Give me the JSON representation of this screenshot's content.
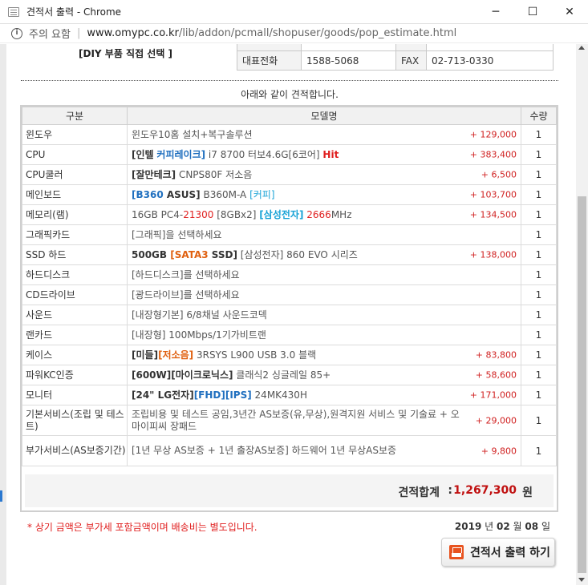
{
  "window": {
    "title": "견적서 출력 - Chrome",
    "minimize": "─",
    "maximize": "☐",
    "close": "✕"
  },
  "address": {
    "warning": "주의 요함",
    "host": "www.omypc.co.kr",
    "path": "/lib/addon/pcmall/shopuser/goods/pop_estimate.html"
  },
  "header": {
    "top_fragment": "",
    "diy_label": "[DIY 부품 직접 선택 ]",
    "info": {
      "top_left": "",
      "top_mid": "",
      "top_right_label": "",
      "top_right": "",
      "phone_label": "대표전화",
      "phone": "1588-5068",
      "fax_label": "FAX",
      "fax": "02-713-0330"
    }
  },
  "subtitle": "아래와 같이 견적합니다.",
  "table": {
    "col_category": "구분",
    "col_model": "모델명",
    "col_qty": "수량",
    "rows": [
      {
        "category": "윈도우",
        "model": "윈도우10홈 설치+복구솔루션",
        "price": "+ 129,000",
        "qty": "1"
      },
      {
        "category": "CPU",
        "price": "+ 383,400",
        "qty": "1"
      },
      {
        "category": "CPU쿨러",
        "price": "+ 6,500",
        "qty": "1"
      },
      {
        "category": "메인보드",
        "price": "+ 103,700",
        "qty": "1"
      },
      {
        "category": "메모리(램)",
        "price": "+ 134,500",
        "qty": "1"
      },
      {
        "category": "그래픽카드",
        "model": "[그래픽]을 선택하세요",
        "price": "",
        "qty": "1"
      },
      {
        "category": "SSD 하드",
        "price": "+ 138,000",
        "qty": "1"
      },
      {
        "category": "하드디스크",
        "model": "[하드디스크]를 선택하세요",
        "price": "",
        "qty": "1"
      },
      {
        "category": "CD드라이브",
        "model": "[광드라이브]를 선택하세요",
        "price": "",
        "qty": "1"
      },
      {
        "category": "사운드",
        "model": "[내장형기본] 6/8채널 사운드코덱",
        "price": "",
        "qty": "1"
      },
      {
        "category": "랜카드",
        "model": "[내장형] 100Mbps/1기가비트랜",
        "price": "",
        "qty": "1"
      },
      {
        "category": "케이스",
        "price": "+ 83,800",
        "qty": "1"
      },
      {
        "category": "파워KC인증",
        "price": "+ 58,600",
        "qty": "1"
      },
      {
        "category": "모니터",
        "price": "+ 171,000",
        "qty": "1"
      },
      {
        "category": "기본서비스(조립 및 테스트)",
        "model": "조립비용 및 테스트 공임,3년간 AS보증(유,무상),원격지원 서비스 및 기술료 + 오마이피씨 장패드",
        "price": "+ 29,000",
        "qty": "1"
      },
      {
        "category": "부가서비스(AS보증기간)",
        "model": "[1년 무상 AS보증 + 1년 출장AS보증] 하드웨어 1년 무상AS보증",
        "price": "+ 9,800",
        "qty": "1"
      }
    ],
    "cpu": {
      "brand": "[인텔",
      "series": "커피레이크]",
      "spec": " i7 8700 터보4.6G[6코어] ",
      "tag": "Hit"
    },
    "cooler": {
      "brand": "[잘만테크]",
      "spec": " CNPS80F 저소음"
    },
    "board": {
      "chip": "[B360",
      "brand": " ASUS]",
      "spec": " B360M-A ",
      "tag": "[커피]"
    },
    "memory": {
      "a": "16GB PC4-",
      "b": "21300",
      "c": " [8GBx2] ",
      "d": "[삼성전자]",
      "e": " ",
      "f": "2666",
      "g": "MHz"
    },
    "ssd": {
      "a": "500GB ",
      "b": "[SATA3",
      "c": " SSD]",
      "d": " [삼성전자] 860 EVO 시리즈"
    },
    "case": {
      "a": "[미들]",
      "b": "[저소음]",
      "c": " 3RSYS L900 USB 3.0 블랙"
    },
    "power": {
      "a": "[600W]",
      "b": "[마이크로닉스]",
      "c": " 클래식2 싱글레일 85+"
    },
    "monitor": {
      "a": "[24\" LG전자]",
      "b": "[FHD]",
      "c": "[IPS]",
      "d": " 24MK430H"
    }
  },
  "total": {
    "label": "견적합계",
    "colon": ":",
    "value": "1,267,300",
    "unit": "원"
  },
  "notice": "* 상기 금액은 부가세 포함금액이며 배송비는 별도입니다.",
  "date": {
    "year": "2019",
    "year_unit": "년",
    "month": "02",
    "month_unit": "월",
    "day": "08",
    "day_unit": "일"
  },
  "print_button": "견적서 출력 하기",
  "colors": {
    "price_red": "#d02020",
    "accent_blue": "#1f6fbf",
    "highlight_cyan": "#19a3d6",
    "warn_orange": "#e8531f"
  }
}
